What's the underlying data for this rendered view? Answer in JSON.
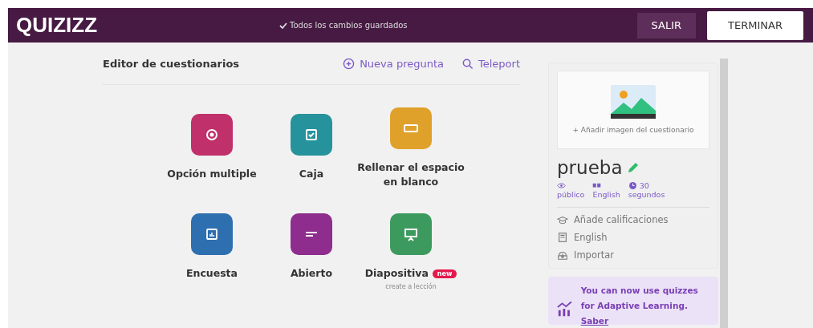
{
  "topbar": {
    "logo": "QUIZIZZ",
    "status": "Todos los cambios guardados",
    "buttons": [
      {
        "label": "SALIR",
        "kind": "dark"
      },
      {
        "label": "TERMINAR",
        "kind": "light"
      }
    ]
  },
  "editor": {
    "title": "Editor de cuestionarios",
    "actions": [
      {
        "label": "Nueva pregunta",
        "kind": "add"
      },
      {
        "label": "Teleport",
        "kind": "search"
      }
    ],
    "types": [
      {
        "label": "Opción multiple",
        "kind": "radio",
        "color": "#c0306a"
      },
      {
        "label": "Caja",
        "kind": "checkbox",
        "color": "#26939c"
      },
      {
        "label": "Rellenar el espacio en blanco",
        "kind": "blank",
        "color": "#e0a12b"
      },
      {
        "label": "Encuesta",
        "kind": "poll",
        "color": "#2e6fb0"
      },
      {
        "label": "Abierto",
        "kind": "open",
        "color": "#8e2d8d"
      },
      {
        "label": "Diapositiva",
        "kind": "slide",
        "color": "#3d9a5e",
        "badge": "new",
        "note": "create a lección"
      }
    ]
  },
  "quiz": {
    "add_image": "+ Añadir imagen del cuestionario",
    "name": "prueba",
    "meta": [
      {
        "kind": "visibility",
        "label": "público"
      },
      {
        "kind": "language",
        "label": "English"
      },
      {
        "kind": "time",
        "value": "30",
        "label": "segundos"
      }
    ],
    "options": [
      {
        "kind": "grade",
        "label": "Añade calificaciones"
      },
      {
        "kind": "book",
        "label": "English"
      },
      {
        "kind": "import",
        "label": "Importar"
      }
    ],
    "promo": {
      "text": "You can now use quizzes for Adaptive Learning. ",
      "link": "Saber"
    }
  }
}
